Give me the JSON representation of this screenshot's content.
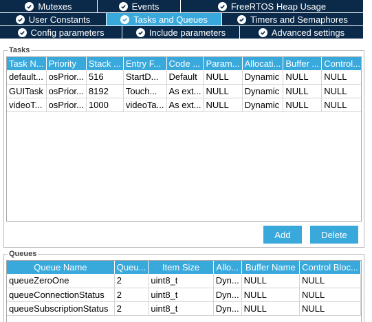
{
  "tabs": {
    "row1": [
      {
        "label": "Mutexes",
        "icon": "check-circle-icon"
      },
      {
        "label": "Events",
        "icon": "check-circle-icon"
      },
      {
        "label": "FreeRTOS Heap Usage",
        "icon": "check-circle-icon"
      }
    ],
    "row2": [
      {
        "label": "User Constants",
        "icon": "check-circle-icon"
      },
      {
        "label": "Tasks and Queues",
        "icon": "check-circle-icon",
        "active": true
      },
      {
        "label": "Timers and Semaphores",
        "icon": "check-circle-icon"
      }
    ],
    "row3": [
      {
        "label": "Config parameters",
        "icon": "check-circle-icon"
      },
      {
        "label": "Include parameters",
        "icon": "check-circle-icon"
      },
      {
        "label": "Advanced settings",
        "icon": "check-circle-icon"
      }
    ]
  },
  "tasks": {
    "title": "Tasks",
    "columns": [
      "Task N...",
      "Priority",
      "Stack ...",
      "Entry F...",
      "Code ...",
      "Param...",
      "Allocati...",
      "Buffer ...",
      "Control..."
    ],
    "rows": [
      [
        "default...",
        "osPrior...",
        "516",
        "StartD...",
        "Default",
        "NULL",
        "Dynamic",
        "NULL",
        "NULL"
      ],
      [
        "GUITask",
        "osPrior...",
        "8192",
        "Touch...",
        "As ext...",
        "NULL",
        "Dynamic",
        "NULL",
        "NULL"
      ],
      [
        "videoT...",
        "osPrior...",
        "1000",
        "videoTa...",
        "As ext...",
        "NULL",
        "Dynamic",
        "NULL",
        "NULL"
      ]
    ],
    "add_label": "Add",
    "delete_label": "Delete"
  },
  "queues": {
    "title": "Queues",
    "columns": [
      "Queue Name",
      "Queu...",
      "Item Size",
      "Allo...",
      "Buffer Name",
      "Control Bloc..."
    ],
    "rows": [
      [
        "queueZeroOne",
        "2",
        "uint8_t",
        "Dyn...",
        "NULL",
        "NULL"
      ],
      [
        "queueConnectionStatus",
        "2",
        "uint8_t",
        "Dyn...",
        "NULL",
        "NULL"
      ],
      [
        "queueSubscriptionStatus",
        "2",
        "uint8_t",
        "Dyn...",
        "NULL",
        "NULL"
      ]
    ]
  },
  "colors": {
    "tab_bg": "#0b2a4a",
    "tab_active": "#39a9dc",
    "accent": "#39a9dc"
  }
}
